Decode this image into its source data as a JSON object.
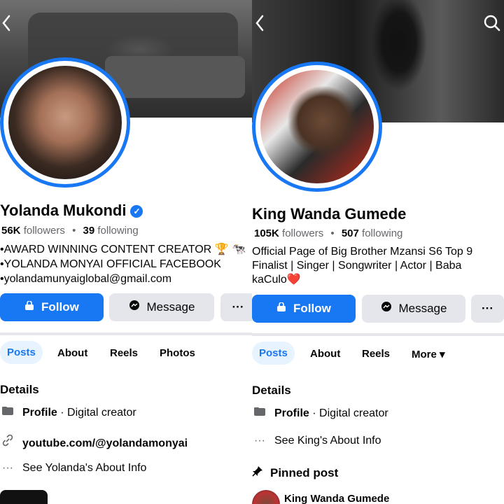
{
  "left": {
    "name": "Yolanda Mukondi",
    "followers_count": "56K",
    "followers_label": "followers",
    "following_count": "39",
    "following_label": "following",
    "separator": "•",
    "bio": [
      "•AWARD WINNING CONTENT CREATOR 🏆 🐄",
      "•YOLANDA MONYAI OFFICIAL FACEBOOK",
      "•yolandamunyaiglobal@gmail.com"
    ],
    "follow_label": "Follow",
    "message_label": "Message",
    "more_label": "···",
    "tabs": [
      "Posts",
      "About",
      "Reels",
      "Photos"
    ],
    "details_title": "Details",
    "profile_label": "Profile",
    "profile_value": " · Digital creator",
    "link": "youtube.com/@yolandamonyai",
    "about_info": "See Yolanda's About Info"
  },
  "right": {
    "name": "King Wanda Gumede",
    "followers_count": "105K",
    "followers_label": "followers",
    "following_count": "507",
    "following_label": "following",
    "separator": "•",
    "bio": [
      "Official Page of Big Brother Mzansi S6 Top 9",
      "Finalist | Singer | Songwriter | Actor | Baba",
      "kaCulo❤️"
    ],
    "follow_label": "Follow",
    "message_label": "Message",
    "more_label": "···",
    "tabs": [
      "Posts",
      "About",
      "Reels",
      "More ▾"
    ],
    "details_title": "Details",
    "profile_label": "Profile",
    "profile_value": " · Digital creator",
    "about_info": "See King's About Info",
    "pinned_title": "Pinned post",
    "pinned_name": "King Wanda Gumede"
  },
  "icons": {
    "back": "‹",
    "search": "⌕",
    "follow": "🔒",
    "message": "💬",
    "profile": "▬",
    "link": "🔗",
    "dots": "···",
    "pin": "📌"
  },
  "colors": {
    "accent": "#1877f2",
    "button_gray": "#e4e6eb",
    "tab_active_bg": "#e7f3ff"
  }
}
